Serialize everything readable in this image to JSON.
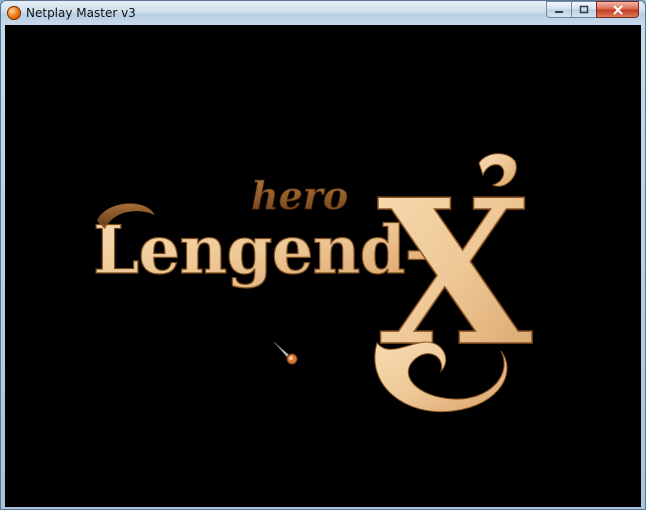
{
  "window": {
    "title": "Netplay Master v3",
    "icon": "orange-orb-icon",
    "controls": [
      "minimize-icon",
      "maximize-icon",
      "close-icon"
    ]
  },
  "game": {
    "logo": {
      "small_word": "hero",
      "main_word": "Lengend-",
      "big_letter": "X"
    },
    "colors": {
      "background": "#000000",
      "logo_light": "#f3d2a2",
      "logo_dark": "#8a5424"
    },
    "cursor": "sword-cursor-icon"
  }
}
